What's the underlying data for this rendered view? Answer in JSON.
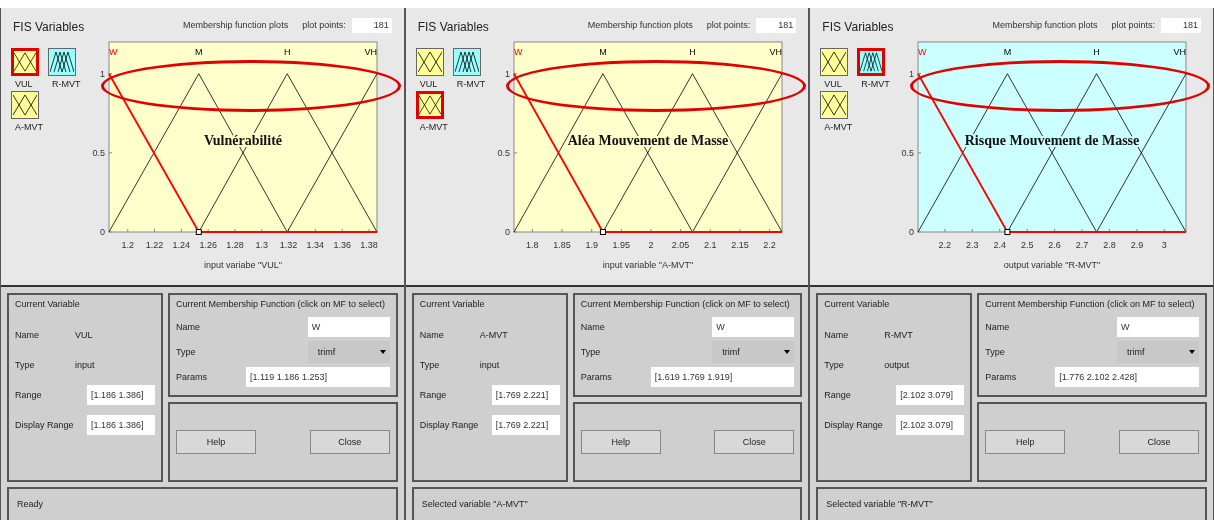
{
  "panels": [
    {
      "fis_variables_label": "FIS Variables",
      "variables": [
        {
          "name": "VUL",
          "kind": "input",
          "selected": true
        },
        {
          "name": "R-MVT",
          "kind": "output",
          "selected": false
        },
        {
          "name": "A-MVT",
          "kind": "input",
          "selected": false
        }
      ],
      "plot_heading": "Membership function plots",
      "plot_points_label": "plot points:",
      "plot_points": "181",
      "chart_data": {
        "type": "line",
        "title": "Vulnérabilité",
        "xlabel": "input variabe \"VUL\"",
        "x": [
          1.186,
          1.253,
          1.319,
          1.386
        ],
        "series": [
          {
            "name": "W",
            "color": "#ff0000",
            "values": [
              1,
              0,
              0,
              0
            ]
          },
          {
            "name": "M",
            "color": "#000000",
            "values": [
              0,
              1,
              0,
              null
            ]
          },
          {
            "name": "H",
            "color": "#000000",
            "values": [
              null,
              0,
              1,
              0
            ]
          },
          {
            "name": "VH",
            "color": "#000000",
            "values": [
              null,
              null,
              0,
              1
            ]
          }
        ],
        "xlim": [
          1.186,
          1.386
        ],
        "ylim": [
          0,
          1.2
        ],
        "xticks": [
          1.2,
          1.22,
          1.24,
          1.26,
          1.28,
          1.3,
          1.32,
          1.34,
          1.36,
          1.38
        ],
        "yticks": [
          0,
          0.5,
          1
        ]
      },
      "current_variable": {
        "title": "Current Variable",
        "name_label": "Name",
        "name": "VUL",
        "type_label": "Type",
        "type": "input",
        "range_label": "Range",
        "range": "[1.186 1.386]",
        "display_range_label": "Display Range",
        "display_range": "[1.186 1.386]"
      },
      "current_mf": {
        "title": "Current Membership Function (click on MF to select)",
        "name_label": "Name",
        "name": "W",
        "type_label": "Type",
        "type": "trimf",
        "params_label": "Params",
        "params": "[1.119 1.186 1.253]"
      },
      "buttons": [
        "Help",
        "Close"
      ],
      "status": "Ready"
    },
    {
      "fis_variables_label": "FIS Variables",
      "variables": [
        {
          "name": "VUL",
          "kind": "input",
          "selected": false
        },
        {
          "name": "R-MVT",
          "kind": "output",
          "selected": false
        },
        {
          "name": "A-MVT",
          "kind": "input",
          "selected": true
        }
      ],
      "plot_heading": "Membership function plots",
      "plot_points_label": "plot points:",
      "plot_points": "181",
      "chart_data": {
        "type": "line",
        "title": "Aléa Mouvement de Masse",
        "xlabel": "input variable \"A-MVT\"",
        "x": [
          1.769,
          1.919,
          2.07,
          2.221
        ],
        "series": [
          {
            "name": "W",
            "color": "#ff0000",
            "values": [
              1,
              0,
              0,
              0
            ]
          },
          {
            "name": "M",
            "color": "#000000",
            "values": [
              0,
              1,
              0,
              null
            ]
          },
          {
            "name": "H",
            "color": "#000000",
            "values": [
              null,
              0,
              1,
              0
            ]
          },
          {
            "name": "VH",
            "color": "#000000",
            "values": [
              null,
              null,
              0,
              1
            ]
          }
        ],
        "xlim": [
          1.769,
          2.221
        ],
        "ylim": [
          0,
          1.2
        ],
        "xticks": [
          1.8,
          1.85,
          1.9,
          1.95,
          2,
          2.05,
          2.1,
          2.15,
          2.2
        ],
        "yticks": [
          0,
          0.5,
          1
        ]
      },
      "current_variable": {
        "title": "Current Variable",
        "name_label": "Name",
        "name": "A-MVT",
        "type_label": "Type",
        "type": "input",
        "range_label": "Range",
        "range": "[1.769 2.221]",
        "display_range_label": "Display Range",
        "display_range": "[1.769 2.221]"
      },
      "current_mf": {
        "title": "Current Membership Function (click on MF to select)",
        "name_label": "Name",
        "name": "W",
        "type_label": "Type",
        "type": "trimf",
        "params_label": "Params",
        "params": "[1.619 1.769 1.919]"
      },
      "buttons": [
        "Help",
        "Close"
      ],
      "status": "Selected variable \"A-MVT\""
    },
    {
      "fis_variables_label": "FIS Variables",
      "variables": [
        {
          "name": "VUL",
          "kind": "input",
          "selected": false
        },
        {
          "name": "R-MVT",
          "kind": "output",
          "selected": true
        },
        {
          "name": "A-MVT",
          "kind": "input",
          "selected": false
        }
      ],
      "plot_heading": "Membership function plots",
      "plot_points_label": "plot points:",
      "plot_points": "181",
      "chart_data": {
        "type": "line",
        "title": "Risque Mouvement de Masse",
        "xlabel": "output variable \"R-MVT\"",
        "x": [
          2.102,
          2.428,
          2.753,
          3.079
        ],
        "series": [
          {
            "name": "W",
            "color": "#ff0000",
            "values": [
              1,
              0,
              0,
              0
            ]
          },
          {
            "name": "M",
            "color": "#000000",
            "values": [
              0,
              1,
              0,
              null
            ]
          },
          {
            "name": "H",
            "color": "#000000",
            "values": [
              null,
              0,
              1,
              0
            ]
          },
          {
            "name": "VH",
            "color": "#000000",
            "values": [
              null,
              null,
              0,
              1
            ]
          }
        ],
        "xlim": [
          2.102,
          3.079
        ],
        "ylim": [
          0,
          1.2
        ],
        "xticks": [
          2.2,
          2.3,
          2.4,
          2.5,
          2.6,
          2.7,
          2.8,
          2.9,
          3
        ],
        "yticks": [
          0,
          0.5,
          1
        ]
      },
      "current_variable": {
        "title": "Current Variable",
        "name_label": "Name",
        "name": "R-MVT",
        "type_label": "Type",
        "type": "output",
        "range_label": "Range",
        "range": "[2.102 3.079]",
        "display_range_label": "Display Range",
        "display_range": "[2.102 3.079]"
      },
      "current_mf": {
        "title": "Current Membership Function (click on MF to select)",
        "name_label": "Name",
        "name": "W",
        "type_label": "Type",
        "type": "trimf",
        "params_label": "Params",
        "params": "[1.776 2.102 2.428]"
      },
      "buttons": [
        "Help",
        "Close"
      ],
      "status": "Selected variable \"R-MVT\""
    }
  ]
}
